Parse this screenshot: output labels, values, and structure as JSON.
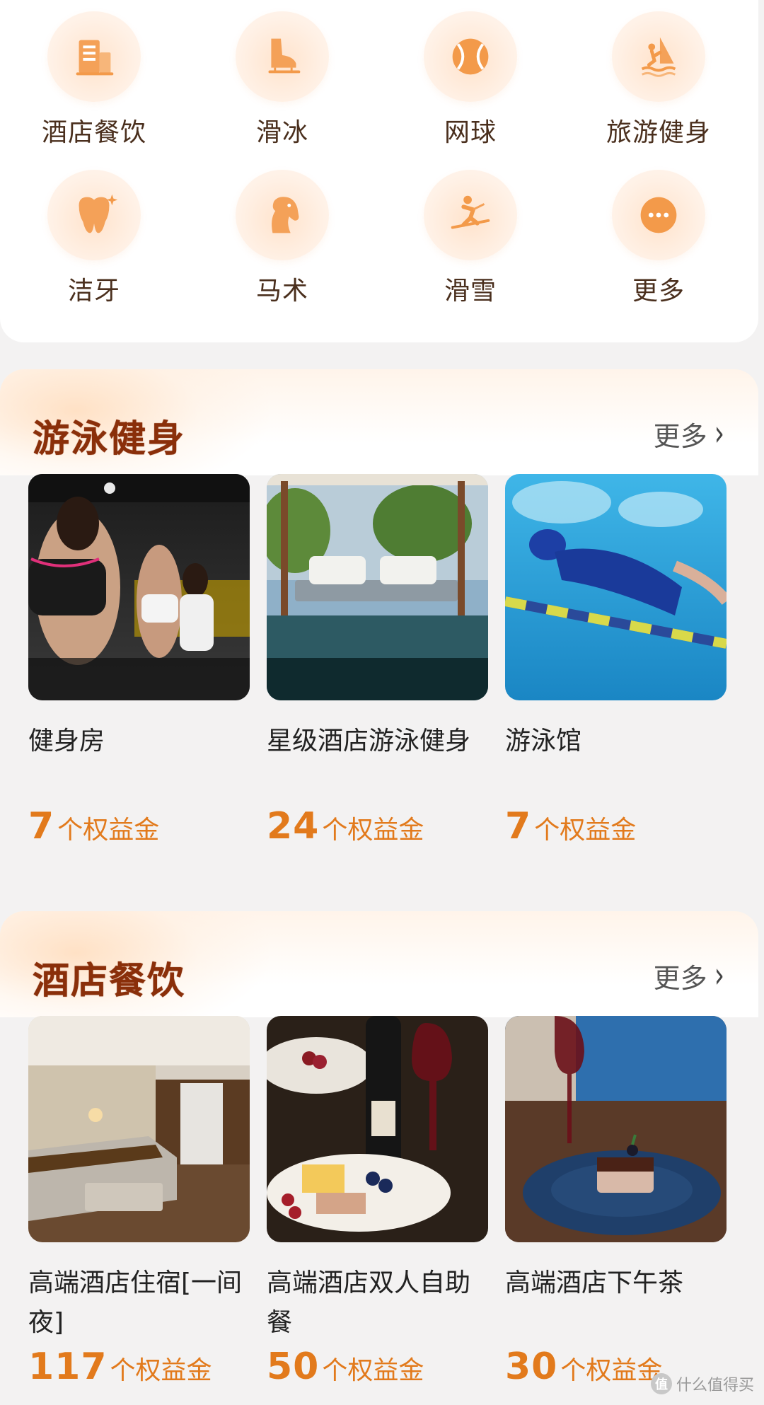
{
  "categories": [
    {
      "label": "酒店餐饮",
      "icon": "hotel-building-icon"
    },
    {
      "label": "滑冰",
      "icon": "ice-skate-icon"
    },
    {
      "label": "网球",
      "icon": "tennis-ball-icon"
    },
    {
      "label": "旅游健身",
      "icon": "windsurf-icon"
    },
    {
      "label": "洁牙",
      "icon": "tooth-sparkle-icon"
    },
    {
      "label": "马术",
      "icon": "horse-head-icon"
    },
    {
      "label": "滑雪",
      "icon": "skier-icon"
    },
    {
      "label": "更多",
      "icon": "more-dots-icon"
    }
  ],
  "sections": [
    {
      "title": "游泳健身",
      "more": "更多",
      "items": [
        {
          "name": "健身房",
          "count": "7",
          "unit": "个权益金",
          "image": "gym-treadmill-photo"
        },
        {
          "name": "星级酒店游泳健身",
          "count": "24",
          "unit": "个权益金",
          "image": "poolside-cabana-photo"
        },
        {
          "name": "游泳馆",
          "count": "7",
          "unit": "个权益金",
          "image": "swimmer-photo"
        }
      ]
    },
    {
      "title": "酒店餐饮",
      "more": "更多",
      "items": [
        {
          "name": "高端酒店住宿[一间夜]",
          "count": "117",
          "unit": "个权益金",
          "image": "hotel-room-photo"
        },
        {
          "name": "高端酒店双人自助餐",
          "count": "50",
          "unit": "个权益金",
          "image": "buffet-wine-photo"
        },
        {
          "name": "高端酒店下午茶",
          "count": "30",
          "unit": "个权益金",
          "image": "afternoon-tea-photo"
        }
      ]
    }
  ],
  "watermark": "什么值得买",
  "colors": {
    "accent": "#e27a1c",
    "title": "#8a2f0a",
    "icon_orange": "#f39a4a"
  }
}
